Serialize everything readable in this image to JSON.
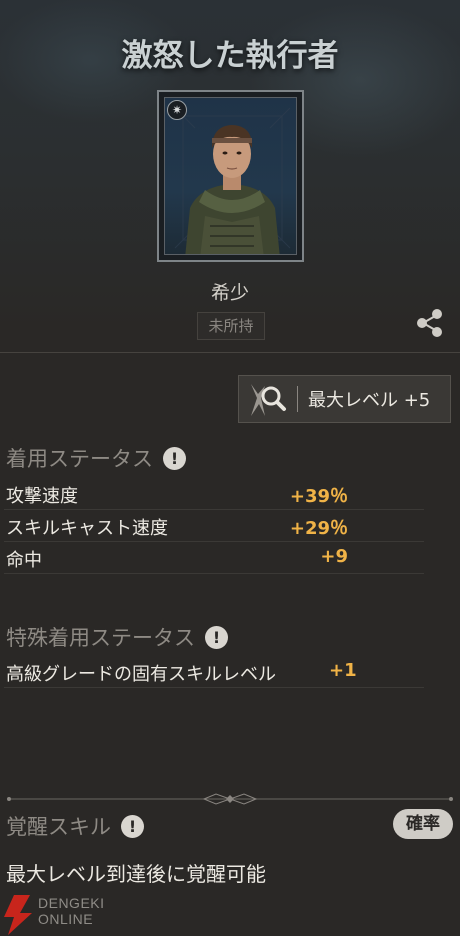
{
  "title": "激怒した執行者",
  "rarity": "希少",
  "owned_status": "未所持",
  "max_level_label": "最大レベル +5",
  "worn_status": {
    "heading": "着用ステータス",
    "rows": [
      {
        "label": "攻撃速度",
        "value": "+39％"
      },
      {
        "label": "スキルキャスト速度",
        "value": "+29％"
      },
      {
        "label": "命中",
        "value": "+9"
      }
    ]
  },
  "special_status": {
    "heading": "特殊着用ステータス",
    "rows": [
      {
        "label": "高級グレードの固有スキルレベル",
        "value": "+1"
      }
    ]
  },
  "awaken": {
    "heading": "覚醒スキル",
    "prob_label": "確率",
    "description": "最大レベル到達後に覚醒可能"
  },
  "info_icon_glyph": "!",
  "corner_icon_glyph": "✷",
  "watermark": {
    "line1": "DENGEKI",
    "line2": "ONLINE"
  },
  "colors": {
    "accent_value": "#f0b347",
    "background": "#2a2826"
  }
}
